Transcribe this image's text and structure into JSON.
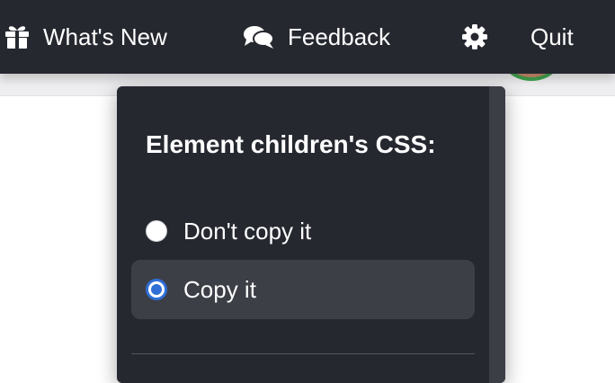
{
  "toolbar": {
    "whats_new_label": "What's New",
    "whats_new_icon": "gift-icon",
    "feedback_label": "Feedback",
    "feedback_icon": "comments-icon",
    "settings_icon": "gear-icon",
    "quit_label": "Quit",
    "background": "#262830"
  },
  "settings_menu": {
    "section_title": "Element children's CSS:",
    "options": [
      {
        "label": "Don't copy it",
        "selected": false
      },
      {
        "label": "Copy it",
        "selected": true
      }
    ],
    "accent": "#2f6fd6",
    "background": "#262830",
    "highlight": "#3d3f47"
  },
  "avatar": {
    "ring_color": "#3fa34d"
  }
}
